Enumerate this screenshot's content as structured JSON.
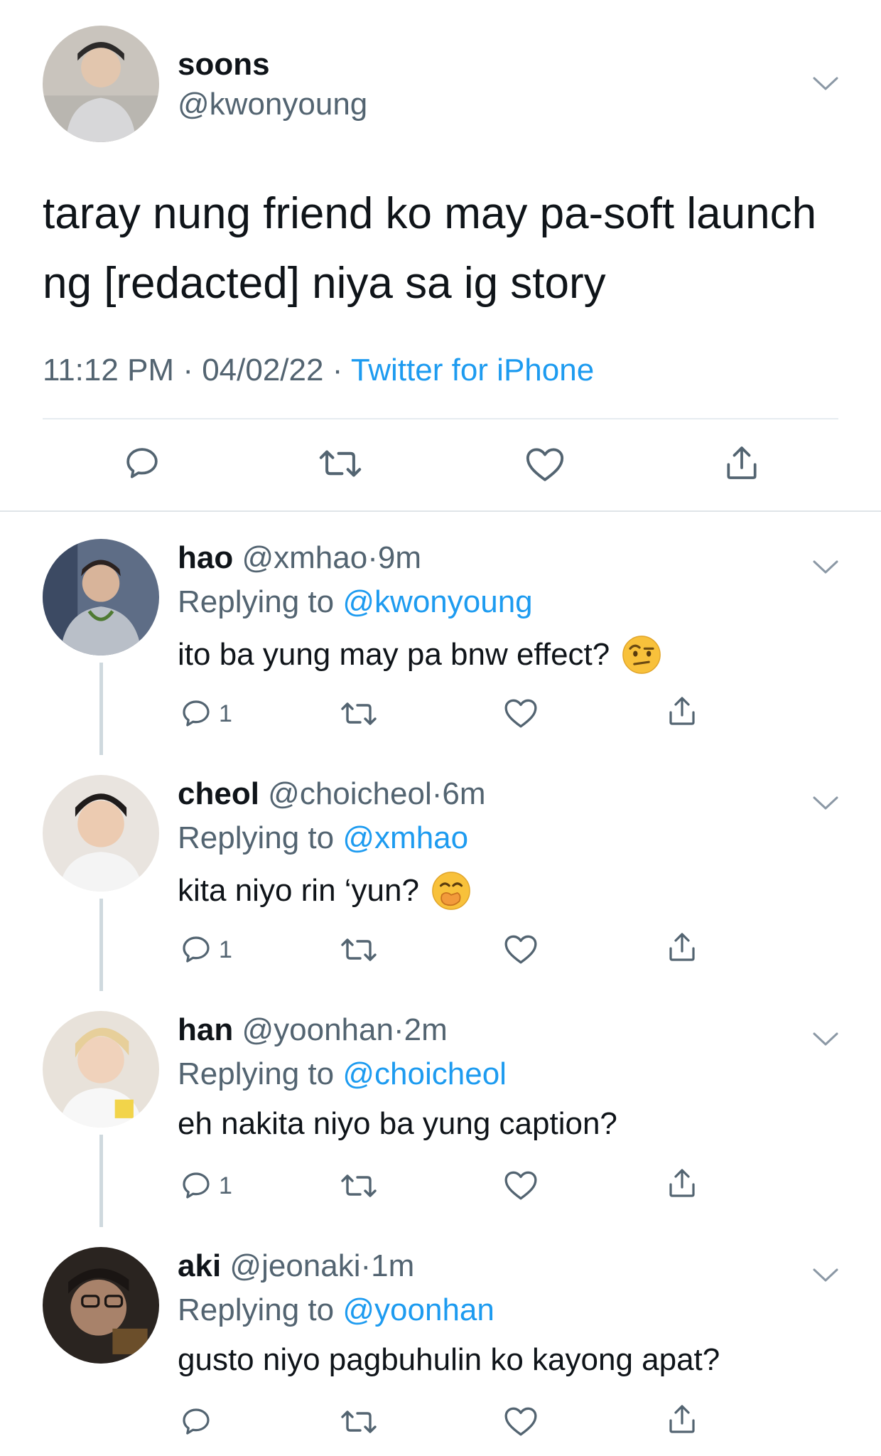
{
  "tweet": {
    "name": "soons",
    "handle": "@kwonyoung",
    "text": "taray nung friend ko may pa-soft launch ng [redacted] niya sa ig story",
    "time": "11:12 PM",
    "date": "04/02/22",
    "source": "Twitter for iPhone",
    "sep": "·"
  },
  "replies": [
    {
      "name": "hao",
      "handle": "@xmhao",
      "time": "9m",
      "replying_prefix": "Replying to",
      "replying_to": "@kwonyoung",
      "text": "ito ba yung may pa bnw effect?",
      "emoji": "raised-eyebrow-emoji",
      "reply_count": "1"
    },
    {
      "name": "cheol",
      "handle": "@choicheol",
      "time": "6m",
      "replying_prefix": "Replying to",
      "replying_to": "@xmhao",
      "text": "kita niyo rin ‘yun?",
      "emoji": "hand-over-mouth-emoji",
      "reply_count": "1"
    },
    {
      "name": "han",
      "handle": "@yoonhan",
      "time": "2m",
      "replying_prefix": "Replying to",
      "replying_to": "@choicheol",
      "text": "eh nakita niyo ba yung caption?",
      "reply_count": "1"
    },
    {
      "name": "aki",
      "handle": "@jeonaki",
      "time": "1m",
      "replying_prefix": "Replying to",
      "replying_to": "@yoonhan",
      "text": "gusto niyo pagbuhulin ko kayong apat?",
      "reply_count": ""
    }
  ],
  "colors": {
    "link": "#1d9bf0",
    "secondary_text": "#536471",
    "icon": "#536471",
    "divider": "#e6ecf0"
  }
}
